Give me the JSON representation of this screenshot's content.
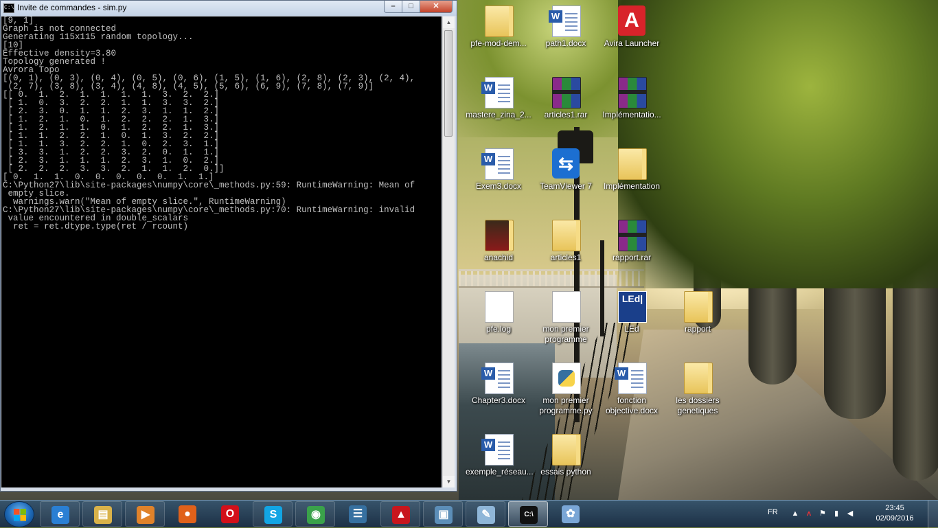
{
  "console_window": {
    "title": "Invite de commandes - sim.py",
    "icon": "cmd-icon",
    "minimize_glyph": "–",
    "maximize_glyph": "□",
    "close_glyph": "✕",
    "output_lines": [
      "[9, 1]",
      "Graph is not connected",
      "Generating 115x115 random topology...",
      "[10]",
      "Effective density=3.80",
      "Topology generated !",
      "Avrora Topo",
      "[(0, 1), (0, 3), (0, 4), (0, 5), (0, 6), (1, 5), (1, 6), (2, 8), (2, 3), (2, 4),",
      " (2, 7), (3, 8), (3, 4), (4, 8), (4, 5), (5, 6), (6, 9), (7, 8), (7, 9)]",
      "[[ 0.  1.  2.  1.  1.  1.  1.  3.  2.  2.]",
      " [ 1.  0.  3.  2.  2.  1.  1.  3.  3.  2.]",
      " [ 2.  3.  0.  1.  1.  2.  3.  1.  1.  2.]",
      " [ 1.  2.  1.  0.  1.  2.  2.  2.  1.  3.]",
      " [ 1.  2.  1.  1.  0.  1.  2.  2.  1.  3.]",
      " [ 1.  1.  2.  2.  1.  0.  1.  3.  2.  2.]",
      " [ 1.  1.  3.  2.  2.  1.  0.  2.  3.  1.]",
      " [ 3.  3.  1.  2.  2.  3.  2.  0.  1.  1.]",
      " [ 2.  3.  1.  1.  1.  2.  3.  1.  0.  2.]",
      " [ 2.  2.  2.  3.  3.  2.  1.  1.  2.  0.]]",
      "[ 0.  1.  1.  0.  0.  0.  0.  0.  1.  1.]",
      "C:\\Python27\\lib\\site-packages\\numpy\\core\\_methods.py:59: RuntimeWarning: Mean of",
      " empty slice.",
      "  warnings.warn(\"Mean of empty slice.\", RuntimeWarning)",
      "C:\\Python27\\lib\\site-packages\\numpy\\core\\_methods.py:70: RuntimeWarning: invalid",
      " value encountered in double_scalars",
      "  ret = ret.dtype.type(ret / rcount)"
    ]
  },
  "desktop_icons": [
    {
      "label": "pfe-mod-dem...",
      "type": "folder",
      "icon": "folder-icon"
    },
    {
      "label": "path1.docx",
      "type": "doc",
      "icon": "word-document-icon"
    },
    {
      "label": "Avira Launcher",
      "type": "avira",
      "icon": "avira-icon",
      "glyph": "A"
    },
    {
      "label": "mastere_zina_2...",
      "type": "doc",
      "icon": "word-document-icon"
    },
    {
      "label": "articles1.rar",
      "type": "rar",
      "icon": "winrar-archive-icon"
    },
    {
      "label": "Implémentatio...",
      "type": "rar",
      "icon": "winrar-archive-icon"
    },
    {
      "label": "Exem3.docx",
      "type": "doc",
      "icon": "word-document-icon"
    },
    {
      "label": "TeamViewer 7",
      "type": "tv",
      "icon": "teamviewer-icon",
      "glyph": "⇆"
    },
    {
      "label": "Implémentation",
      "type": "folder",
      "icon": "folder-icon"
    },
    {
      "label": "anachid",
      "type": "folder-dark",
      "icon": "folder-icon"
    },
    {
      "label": "articles1",
      "type": "folder",
      "icon": "folder-icon"
    },
    {
      "label": "rapport.rar",
      "type": "rar",
      "icon": "winrar-archive-icon"
    },
    {
      "label": "pfe.log",
      "type": "blank",
      "icon": "text-file-icon"
    },
    {
      "label": "mon premier programme",
      "type": "blank",
      "icon": "file-icon"
    },
    {
      "label": "LEd",
      "type": "led",
      "icon": "led-app-icon",
      "glyph": "LEd|"
    },
    {
      "label": "rapport",
      "type": "folder",
      "icon": "folder-icon"
    },
    {
      "label": "Chapter3.docx",
      "type": "doc",
      "icon": "word-document-icon"
    },
    {
      "label": "mon premier programme.py",
      "type": "py",
      "icon": "python-file-icon"
    },
    {
      "label": "fonction objective.docx",
      "type": "doc",
      "icon": "word-document-icon"
    },
    {
      "label": "les dossiers genetiques",
      "type": "folder",
      "icon": "folder-icon"
    },
    {
      "label": "exemple_réseau...",
      "type": "doc",
      "icon": "word-document-icon"
    },
    {
      "label": "essais python",
      "type": "folder",
      "icon": "folder-icon"
    }
  ],
  "taskbar": {
    "start_icon": "windows-start-icon",
    "items": [
      {
        "icon": "internet-explorer-icon",
        "glyph": "e",
        "color": "#2a7fd4",
        "state": "pinned"
      },
      {
        "icon": "file-explorer-icon",
        "glyph": "▤",
        "color": "#d9b24a",
        "state": "pinned"
      },
      {
        "icon": "media-player-icon",
        "glyph": "▶",
        "color": "#e0822a",
        "state": "pinned"
      },
      {
        "icon": "firefox-icon",
        "glyph": "●",
        "color": "#e0611a",
        "state": "none"
      },
      {
        "icon": "opera-icon",
        "glyph": "O",
        "color": "#d2101a",
        "state": "none"
      },
      {
        "icon": "skype-icon",
        "glyph": "S",
        "color": "#12a5e4",
        "state": "pinned"
      },
      {
        "icon": "chrome-icon",
        "glyph": "◉",
        "color": "#3aa24a",
        "state": "pinned"
      },
      {
        "icon": "python-icon",
        "glyph": "☰",
        "color": "#3670a0",
        "state": "none"
      },
      {
        "icon": "adobe-reader-icon",
        "glyph": "▲",
        "color": "#c8161d",
        "state": "pinned"
      },
      {
        "icon": "image-viewer-icon",
        "glyph": "▣",
        "color": "#5c8eb8",
        "state": "pinned"
      },
      {
        "icon": "notepad-icon",
        "glyph": "✎",
        "color": "#8fb6d8",
        "state": "pinned"
      },
      {
        "icon": "cmd-icon",
        "glyph": "C:\\",
        "color": "#111111",
        "state": "active"
      },
      {
        "icon": "paint-icon",
        "glyph": "✿",
        "color": "#7aa6d6",
        "state": "none"
      }
    ],
    "tray": {
      "language": "FR",
      "icons": [
        "show-hidden-icons-icon",
        "avira-tray-icon",
        "action-center-flag-icon",
        "network-icon",
        "volume-icon"
      ],
      "time": "23:45",
      "date": "02/09/2016"
    }
  }
}
